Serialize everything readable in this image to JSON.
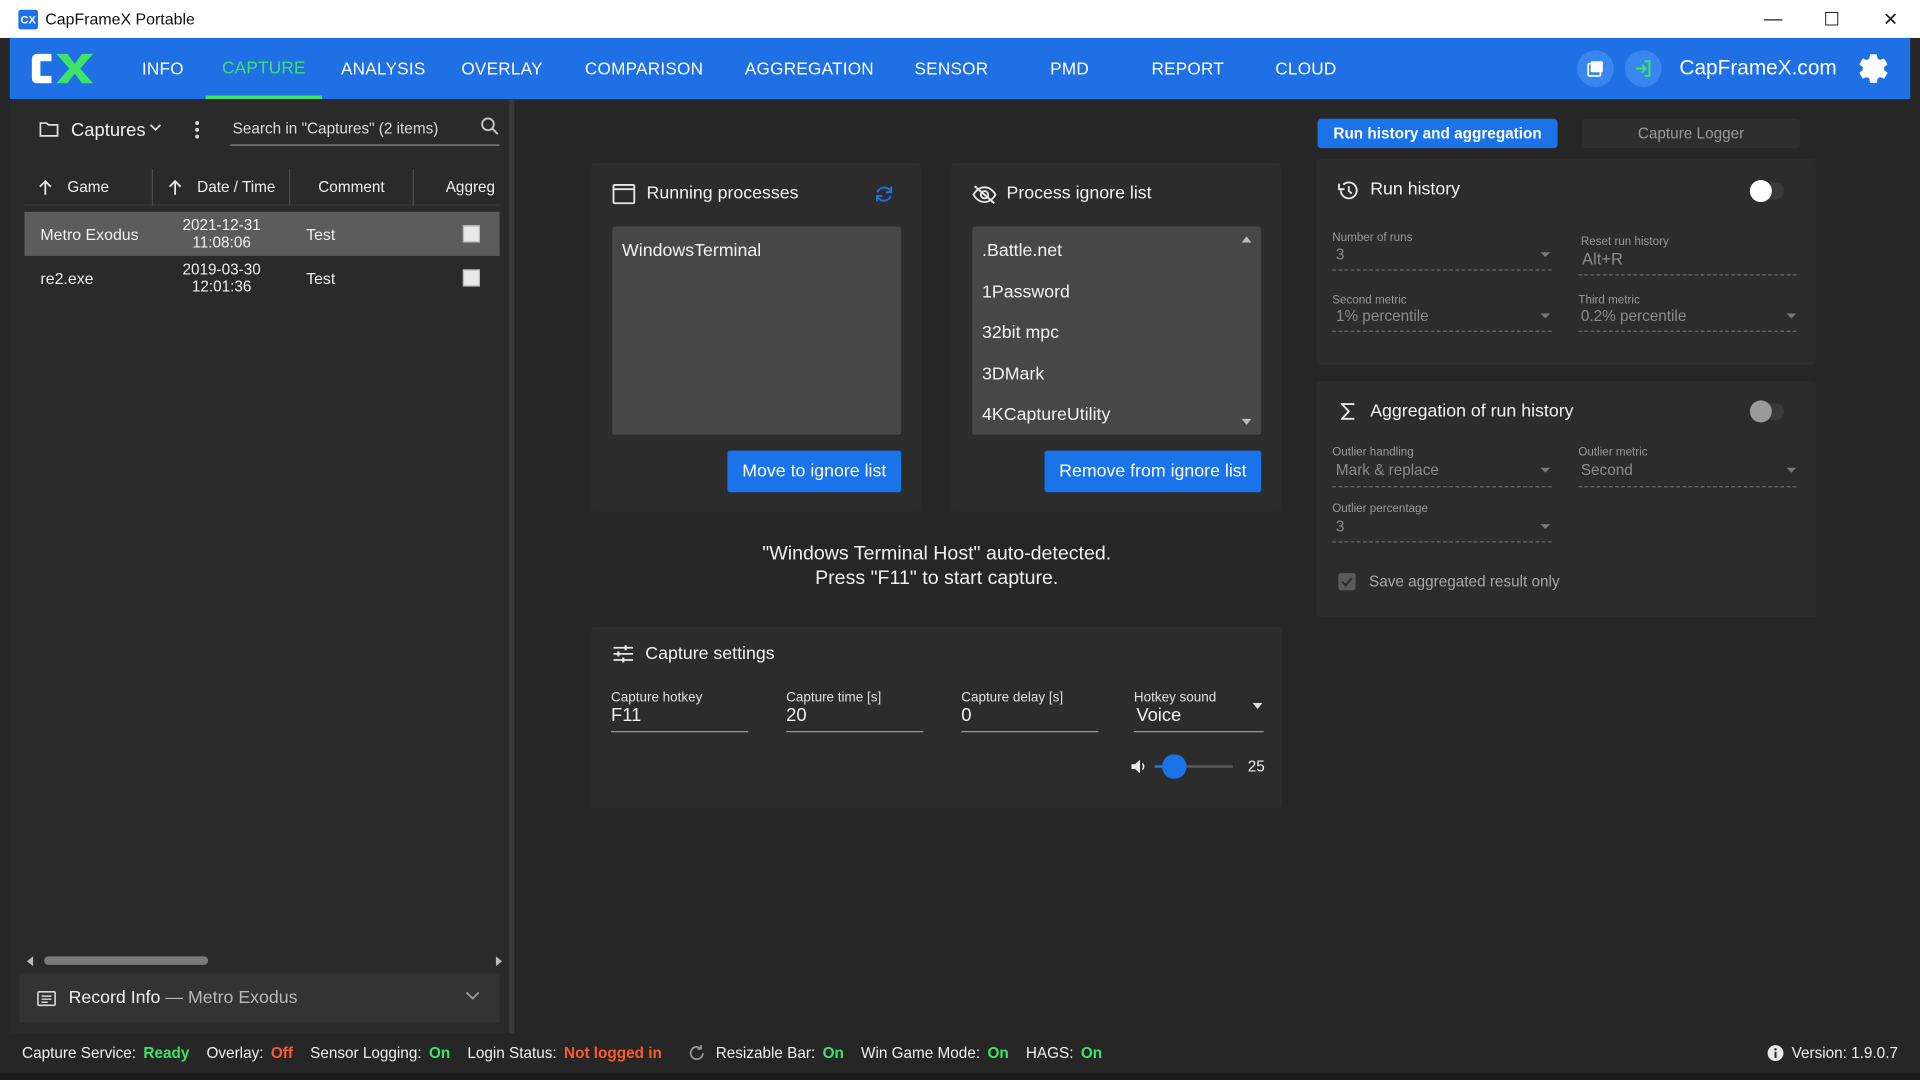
{
  "window": {
    "title": "CapFrameX Portable",
    "logo_text": "CX",
    "minimize": "—",
    "maximize": "☐",
    "close": "✕"
  },
  "nav": {
    "items": [
      {
        "label": "INFO",
        "w": 70
      },
      {
        "label": "CAPTURE",
        "w": 95,
        "active": true
      },
      {
        "label": "ANALYSIS",
        "w": 100
      },
      {
        "label": "OVERLAY",
        "w": 94
      },
      {
        "label": "COMPARISON",
        "w": 138
      },
      {
        "label": "AGGREGATION",
        "w": 132
      },
      {
        "label": "SENSOR",
        "w": 100
      },
      {
        "label": "PMD",
        "w": 93
      },
      {
        "label": "REPORT",
        "w": 100
      },
      {
        "label": "CLOUD",
        "w": 93
      }
    ],
    "site": "CapFrameX.com"
  },
  "captures": {
    "title": "Captures",
    "search_placeholder": "Search in \"Captures\" (2 items)",
    "columns": {
      "game": "Game",
      "datetime": "Date / Time",
      "comment": "Comment",
      "aggregate": "Aggreg"
    },
    "rows": [
      {
        "game": "Metro Exodus",
        "date": "2021-12-31",
        "time": "11:08:06",
        "comment": "Test"
      },
      {
        "game": "re2.exe",
        "date": "2019-03-30",
        "time": "12:01:36",
        "comment": "Test"
      }
    ],
    "record_info": {
      "label": "Record Info",
      "separator": " — ",
      "game": "Metro Exodus"
    }
  },
  "running": {
    "title": "Running processes",
    "items": [
      "WindowsTerminal"
    ],
    "button": "Move to ignore list"
  },
  "ignore": {
    "title": "Process ignore list",
    "items": [
      ".Battle.net",
      "1Password",
      "32bit mpc",
      "3DMark",
      "4KCaptureUtility"
    ],
    "button": "Remove from ignore list"
  },
  "detect": {
    "line1": "\"Windows Terminal Host\" auto-detected.",
    "line2": "Press \"F11\" to start capture."
  },
  "capture_settings": {
    "title": "Capture settings",
    "hotkey_label": "Capture hotkey",
    "hotkey_value": "F11",
    "time_label": "Capture time [s]",
    "time_value": "20",
    "delay_label": "Capture delay [s]",
    "delay_value": "0",
    "sound_label": "Hotkey sound",
    "sound_value": "Voice",
    "volume": "25",
    "volume_fraction": 0.25
  },
  "right": {
    "tab_run": "Run history and aggregation",
    "tab_logger": "Capture Logger",
    "run_history": {
      "title": "Run history",
      "enabled": true,
      "runs_label": "Number of runs",
      "runs_value": "3",
      "reset_label": "Reset run history",
      "reset_value": "Alt+R",
      "second_label": "Second metric",
      "second_value": "1% percentile",
      "third_label": "Third metric",
      "third_value": "0.2% percentile"
    },
    "aggregation": {
      "title": "Aggregation of run history",
      "enabled": false,
      "outlier_label": "Outlier handling",
      "outlier_value": "Mark & replace",
      "metric_label": "Outlier metric",
      "metric_value": "Second",
      "pct_label": "Outlier percentage",
      "pct_value": "3",
      "save_only": "Save aggregated result only"
    }
  },
  "status": {
    "service_label": "Capture Service:",
    "service_value": "Ready",
    "overlay_label": "Overlay:",
    "overlay_value": "Off",
    "sensor_label": "Sensor Logging:",
    "sensor_value": "On",
    "login_label": "Login Status:",
    "login_value": "Not logged in",
    "rebar_label": "Resizable Bar:",
    "rebar_value": "On",
    "gamemode_label": "Win Game Mode:",
    "gamemode_value": "On",
    "hags_label": "HAGS:",
    "hags_value": "On",
    "version": "Version: 1.9.0.7"
  },
  "colors": {
    "brand_blue": "#1f6fe5",
    "button_blue": "#1a73e8",
    "accent_green": "#3ee36a",
    "status_red": "#ff5a2e"
  }
}
